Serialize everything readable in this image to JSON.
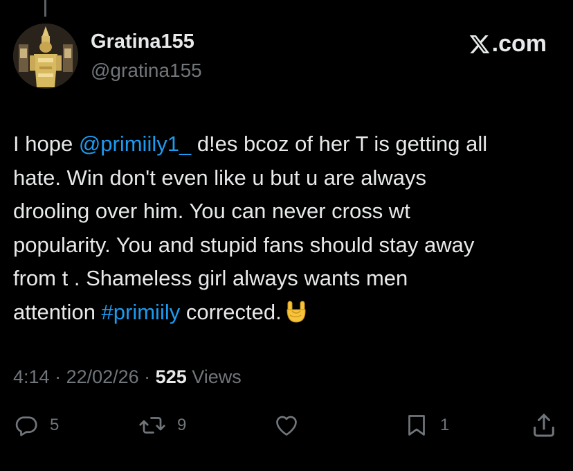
{
  "author": {
    "display_name": "Gratina155",
    "handle": "@gratina155",
    "avatar_icon": "avatar-temple-statue"
  },
  "brand": {
    "logo_icon": "x-logo-icon",
    "label": ".com"
  },
  "tweet": {
    "lines": [
      [
        "I hope  ",
        "@primiily1_",
        " d!es bcoz of her T is getting all"
      ],
      [
        "hate. Win don't even like u but u are always"
      ],
      [
        "drooling over him. You can never cross wt"
      ],
      [
        "popularity. You and stupid fans should stay away"
      ],
      [
        "from t . Shameless girl always wants men"
      ],
      [
        "attention  ",
        "#primiily",
        " corrected."
      ]
    ],
    "mention": "@primiily1_",
    "hashtag": "#primiily",
    "emoji": "sign-of-the-horns"
  },
  "meta": {
    "time": "4:14",
    "separator": " · ",
    "date": "22/02/26",
    "views_count": "525",
    "views_label": " Views"
  },
  "actions": {
    "reply_count": "5",
    "repost_count": "9",
    "like_count": "",
    "bookmark_count": "1"
  },
  "colors": {
    "background": "#000000",
    "text": "#e7e9ea",
    "muted": "#71767b",
    "link": "#1d9bf0"
  }
}
